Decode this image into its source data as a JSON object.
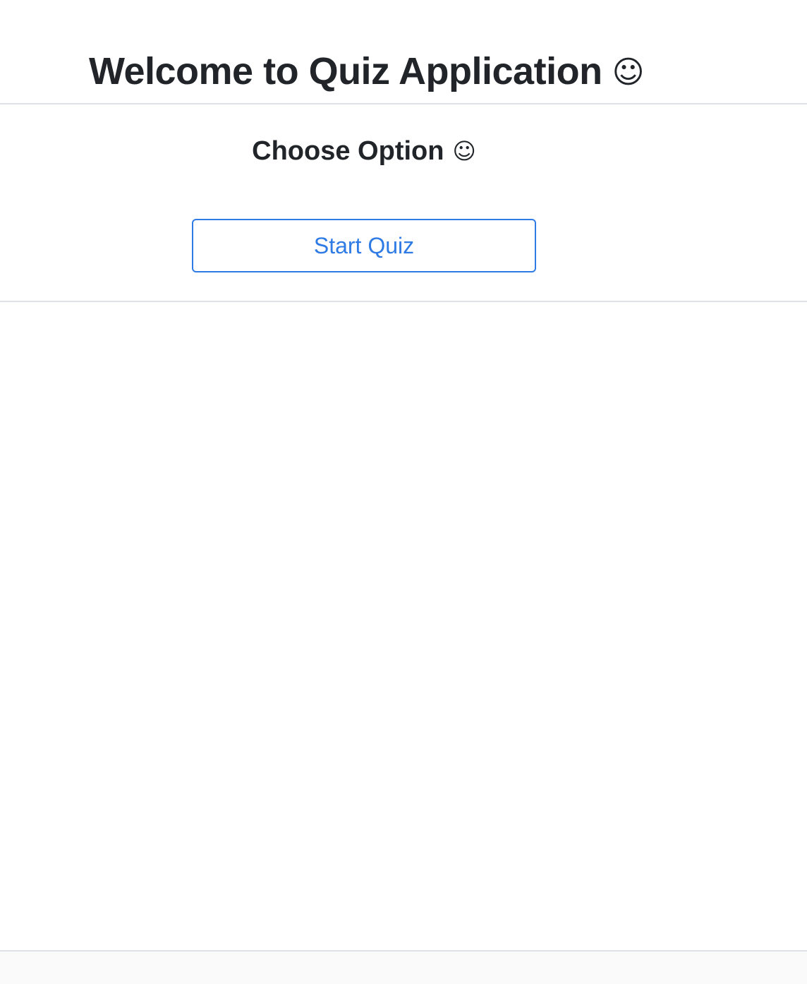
{
  "header": {
    "title": "Welcome to Quiz Application",
    "title_icon": "☺",
    "title_icon_name": "smiley-face-icon"
  },
  "main": {
    "section_title": "Choose Option",
    "section_icon": "☺",
    "section_icon_name": "smiley-face-icon",
    "start_button_label": "Start Quiz"
  },
  "colors": {
    "accent": "#2f7be6",
    "text": "#212529",
    "divider": "#dee2e6",
    "background": "#ffffff"
  }
}
